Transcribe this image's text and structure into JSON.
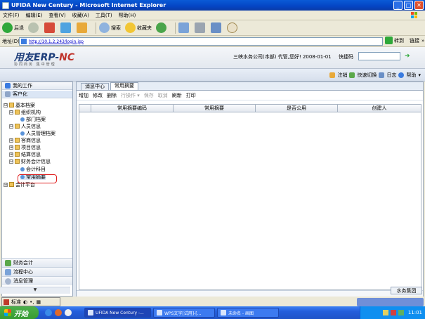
{
  "window": {
    "title": "UFIDA New Century - Microsoft Internet Explorer",
    "min": "_",
    "max": "□",
    "close": "✕"
  },
  "menu": [
    "文件(F)",
    "编辑(E)",
    "查看(V)",
    "收藏(A)",
    "工具(T)",
    "帮助(H)"
  ],
  "toolbar": {
    "back": "后退",
    "search": "搜索",
    "favorites": "收藏夹"
  },
  "address": {
    "label": "地址(D)",
    "url": "http://10.1.2.243/login.jsp",
    "go": "转到",
    "links": "链接",
    "more": "»"
  },
  "header": {
    "logo_main": "用友ERP-",
    "logo_accent": "NC",
    "logo_sub": "协同商务 集中管理",
    "company": "三峡水务公司(本部) 代管,您好! 2008-01-01",
    "quickcode_label": "快捷码",
    "go_arrow": "➜"
  },
  "subbar": {
    "logout": "注销",
    "quickswitch": "快速切换",
    "log": "日志",
    "help": "帮助"
  },
  "sidebar": {
    "my_work": "我的工作",
    "customize": "客户化",
    "tree": [
      {
        "label": "基本档案",
        "level": 0,
        "type": "folder",
        "sign": "⊟"
      },
      {
        "label": "组织机构",
        "level": 1,
        "type": "folder",
        "sign": "⊟"
      },
      {
        "label": "部门档案",
        "level": 2,
        "type": "leaf"
      },
      {
        "label": "人员信息",
        "level": 1,
        "type": "folder",
        "sign": "⊟"
      },
      {
        "label": "人员管理档案",
        "level": 2,
        "type": "leaf"
      },
      {
        "label": "客商信息",
        "level": 1,
        "type": "folder",
        "sign": "⊞"
      },
      {
        "label": "项目信息",
        "level": 1,
        "type": "folder",
        "sign": "⊞"
      },
      {
        "label": "结算信息",
        "level": 1,
        "type": "folder",
        "sign": "⊞"
      },
      {
        "label": "财务会计信息",
        "level": 1,
        "type": "folder",
        "sign": "⊟"
      },
      {
        "label": "会计科目",
        "level": 2,
        "type": "leaf"
      },
      {
        "label": "常用摘要",
        "level": 2,
        "type": "leaf"
      },
      {
        "label": "会计平台",
        "level": 0,
        "type": "folder",
        "sign": "⊞"
      }
    ],
    "footer": [
      "财务会计",
      "流程中心",
      "消息管理"
    ],
    "scroll": "▼"
  },
  "tabs": [
    "消息中心",
    "常用摘要"
  ],
  "actions": [
    {
      "label": "增加",
      "enabled": true
    },
    {
      "label": "修改",
      "enabled": true
    },
    {
      "label": "删除",
      "enabled": true
    },
    {
      "label": "行操作 ▾",
      "enabled": false
    },
    {
      "label": "保存",
      "enabled": false
    },
    {
      "label": "取消",
      "enabled": false
    },
    {
      "label": "刷新",
      "enabled": true
    },
    {
      "label": "打印",
      "enabled": true
    }
  ],
  "grid": {
    "columns": [
      "常用摘要编码",
      "常用摘要",
      "是否公用",
      "创建人"
    ]
  },
  "status": {
    "group": "水务集团"
  },
  "ime": {
    "mode": "标准"
  },
  "taskbar": {
    "start": "开始",
    "tasks": [
      "UFIDA New Century -...",
      "WPS文字[试用]-[...",
      "未命名 - 画图"
    ],
    "clock": "11:01"
  }
}
